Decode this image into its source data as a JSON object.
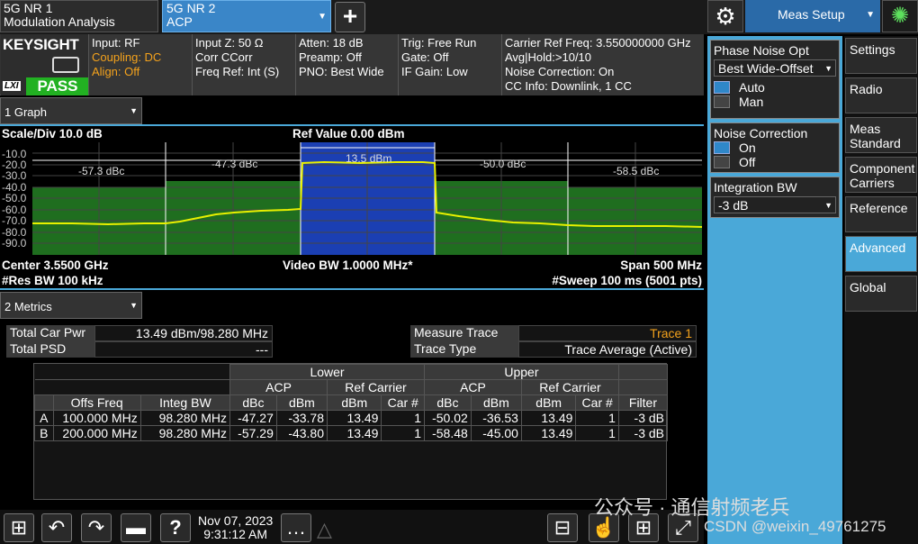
{
  "tabs": [
    {
      "line1": "5G NR 1",
      "line2": "Modulation Analysis"
    },
    {
      "line1": "5G NR 2",
      "line2": "ACP"
    }
  ],
  "add_tab_label": "+",
  "meas_setup_label": "Meas Setup",
  "brand": {
    "name": "KEYSIGHT",
    "lxi": "LXI",
    "pass": "PASS"
  },
  "status": {
    "col1": [
      "Input: RF",
      "Coupling: DC",
      "Align: Off"
    ],
    "col2": [
      "Input Z: 50 Ω",
      "Corr CCorr",
      "Freq Ref: Int (S)"
    ],
    "col3": [
      "Atten: 18 dB",
      "Preamp: Off",
      "PNO: Best Wide"
    ],
    "col4": [
      "Trig: Free Run",
      "Gate: Off",
      "IF Gain: Low"
    ],
    "col5": [
      "Carrier Ref Freq: 3.550000000 GHz",
      "Avg|Hold:>10/10",
      "Noise Correction: On",
      "CC Info: Downlink, 1 CC"
    ]
  },
  "graph": {
    "selector": "1 Graph",
    "scale_div": "Scale/Div 10.0 dB",
    "ref_value": "Ref Value 0.00 dBm",
    "yticks": [
      "-10.0",
      "-20.0",
      "-30.0",
      "-40.0",
      "-50.0",
      "-60.0",
      "-70.0",
      "-80.0",
      "-90.0"
    ],
    "offset_labels": [
      "-57.3 dBc",
      "-47.3 dBc",
      "13.5 dBm",
      "-50.0 dBc",
      "-58.5 dBc"
    ],
    "center": "Center 3.5500 GHz",
    "video_bw": "Video BW 1.0000 MHz*",
    "span": "Span 500 MHz",
    "res_bw": "#Res BW 100 kHz",
    "sweep": "#Sweep 100 ms (5001 pts)"
  },
  "metrics": {
    "selector": "2 Metrics",
    "total_car_pwr_label": "Total Car Pwr",
    "total_car_pwr_value": "13.49 dBm/98.280 MHz",
    "total_psd_label": "Total PSD",
    "total_psd_value": "---",
    "measure_trace_label": "Measure Trace",
    "measure_trace_value": "Trace 1",
    "trace_type_label": "Trace Type",
    "trace_type_value": "Trace Average (Active)"
  },
  "acp_table": {
    "group_lower": "Lower",
    "group_upper": "Upper",
    "acp": "ACP",
    "ref_carrier": "Ref Carrier",
    "headers": [
      "Offs Freq",
      "Integ BW",
      "dBc",
      "dBm",
      "dBm",
      "Car #",
      "dBc",
      "dBm",
      "dBm",
      "Car #",
      "Filter"
    ],
    "rows": [
      [
        "A",
        "100.000 MHz",
        "98.280 MHz",
        "-47.27",
        "-33.78",
        "13.49",
        "1",
        "-50.02",
        "-36.53",
        "13.49",
        "1",
        "-3 dB"
      ],
      [
        "B",
        "200.000 MHz",
        "98.280 MHz",
        "-57.29",
        "-43.80",
        "13.49",
        "1",
        "-58.48",
        "-45.00",
        "13.49",
        "1",
        "-3 dB"
      ]
    ]
  },
  "side_panel": {
    "phase_noise_title": "Phase Noise Opt",
    "phase_noise_value": "Best Wide-Offset",
    "pn_auto": "Auto",
    "pn_man": "Man",
    "noise_corr_title": "Noise Correction",
    "nc_on": "On",
    "nc_off": "Off",
    "integ_bw_title": "Integration BW",
    "integ_bw_value": "-3 dB"
  },
  "menu": [
    "Settings",
    "Radio",
    "Meas Standard",
    "Component Carriers",
    "Reference",
    "Advanced",
    "Global"
  ],
  "taskbar": {
    "date": "Nov 07, 2023",
    "time": "9:31:12 AM",
    "help": "?"
  },
  "watermark": {
    "wechat": "公众号 · 通信射频老兵",
    "csdn": "CSDN @weixin_49761275"
  },
  "colors": {
    "accent": "#4aa8d8",
    "pass": "#22b122",
    "trace": "#e8f000",
    "channel": "#1b3fb3",
    "band": "#1f6e1f",
    "warn": "#f4a21c"
  }
}
